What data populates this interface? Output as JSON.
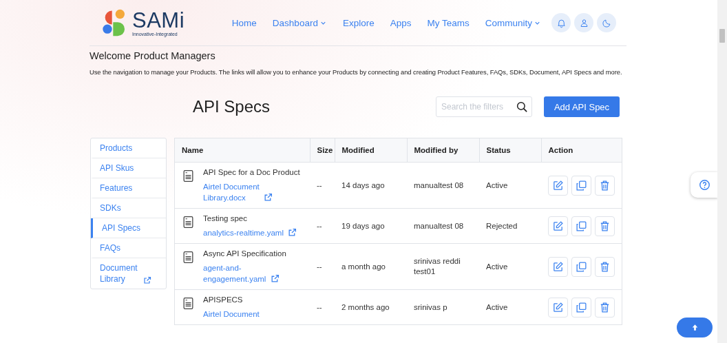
{
  "header": {
    "logo": {
      "name": "SAMi",
      "tagline": "Innovative-Integrated"
    },
    "nav": [
      {
        "label": "Home",
        "kind": "link"
      },
      {
        "label": "Dashboard",
        "kind": "dropdown"
      },
      {
        "label": "Explore",
        "kind": "link"
      },
      {
        "label": "Apps",
        "kind": "link"
      },
      {
        "label": "My Teams",
        "kind": "link"
      },
      {
        "label": "Community",
        "kind": "dropdown"
      }
    ]
  },
  "intro": {
    "title": "Welcome Product Managers",
    "text": "Use the navigation to manage your Products. The links will allow you to enhance your Products by connecting and creating Product Features, FAQs, SDKs, Document, API Specs and more."
  },
  "page_title": "API Specs",
  "search": {
    "placeholder": "Search the filters"
  },
  "add_button": "Add API Spec",
  "sidebar": {
    "items": [
      {
        "label": "Products",
        "kind": "link",
        "selected": false
      },
      {
        "label": "API Skus",
        "kind": "link",
        "selected": false
      },
      {
        "label": "Features",
        "kind": "link",
        "selected": false
      },
      {
        "label": "SDKs",
        "kind": "link",
        "selected": false
      },
      {
        "label": "API Specs",
        "kind": "link",
        "selected": true
      },
      {
        "label": "FAQs",
        "kind": "link",
        "selected": false
      },
      {
        "label": "Document Library",
        "kind": "external",
        "selected": false
      }
    ]
  },
  "table": {
    "columns": [
      "Name",
      "Size",
      "Modified",
      "Modified by",
      "Status",
      "Action"
    ],
    "rows": [
      {
        "name": "API Spec for a Doc Product",
        "file": "Airtel Document Library.docx",
        "external": true,
        "size": "--",
        "modified": "14 days ago",
        "modified_by": "manualtest 08",
        "status": "Active"
      },
      {
        "name": "Testing spec",
        "file": "analytics-realtime.yaml",
        "external": true,
        "size": "--",
        "modified": "19 days ago",
        "modified_by": "manualtest 08",
        "status": "Rejected"
      },
      {
        "name": "Async API Specification",
        "file": "agent-and-engagement.yaml",
        "external": true,
        "size": "--",
        "modified": "a month ago",
        "modified_by": "srinivas reddi test01",
        "status": "Active"
      },
      {
        "name": "APISPECS",
        "file": "Airtel Document",
        "external": false,
        "size": "--",
        "modified": "2 months ago",
        "modified_by": "srinivas p",
        "status": "Active"
      }
    ]
  }
}
